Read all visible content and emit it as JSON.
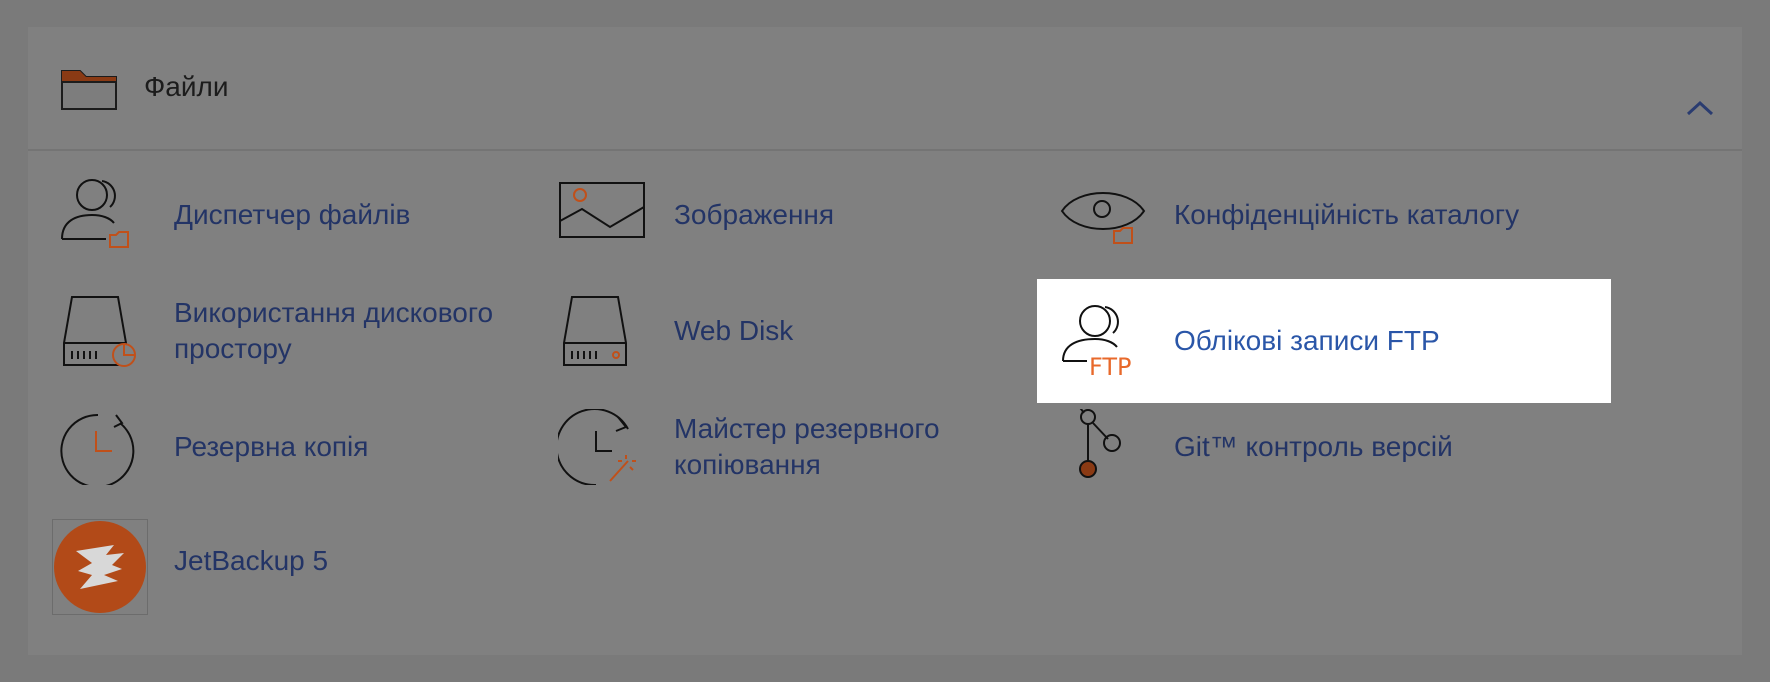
{
  "section": {
    "title": "Файли",
    "icon": "folder-icon",
    "collapse_icon": "chevron-up-icon"
  },
  "items": [
    {
      "label": "Диспетчер файлів",
      "icon": "file-manager-icon"
    },
    {
      "label": "Зображення",
      "icon": "images-icon"
    },
    {
      "label": "Конфіденційність каталогу",
      "icon": "directory-privacy-icon"
    },
    {
      "label": "Використання дискового простору",
      "icon": "disk-usage-icon"
    },
    {
      "label": "Web Disk",
      "icon": "web-disk-icon"
    },
    {
      "label": "Облікові записи FTP",
      "icon": "ftp-accounts-icon",
      "highlighted": true,
      "icon_text": "FTP"
    },
    {
      "label": "Резервна копія",
      "icon": "backup-icon"
    },
    {
      "label": "Майстер резервного копіювання",
      "icon": "backup-wizard-icon"
    },
    {
      "label": "Git™ контроль версій",
      "icon": "git-icon"
    },
    {
      "label": "JetBackup 5",
      "icon": "jetbackup-logo-icon"
    }
  ],
  "colors": {
    "accent_orange": "#c0501a",
    "link_blue": "#233466",
    "highlight_link_blue": "#2a56a8",
    "ftp_orange": "#e8692b"
  }
}
